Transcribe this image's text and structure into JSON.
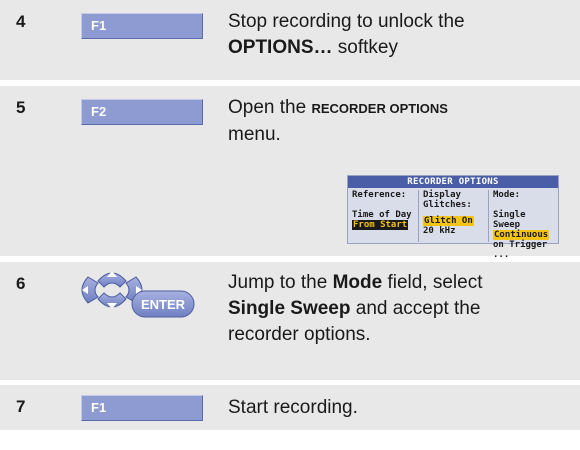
{
  "steps": [
    {
      "number": "4",
      "key_label": "F1",
      "desc_line1": "Stop recording to unlock the",
      "desc_bold": "OPTIONS…",
      "desc_after": " softkey"
    },
    {
      "number": "5",
      "key_label": "F2",
      "desc_before": "Open the ",
      "desc_bold": "RECORDER OPTIONS",
      "desc_after": "menu."
    },
    {
      "number": "6",
      "key_label": "ENTER",
      "desc_part1": "Jump to the ",
      "desc_bold1": "Mode",
      "desc_part2": " field, select",
      "desc_bold2": "Single Sweep",
      "desc_part3": " and accept the",
      "desc_part4": "recorder options."
    },
    {
      "number": "7",
      "key_label": "F1",
      "desc": "Start recording."
    }
  ],
  "recorder_options": {
    "title": "RECORDER OPTIONS",
    "col1": {
      "header": "Reference:",
      "opt1": "Time of Day",
      "opt2_selected": "From Start"
    },
    "col2": {
      "header1": "Display",
      "header2": "Glitches:",
      "opt1_selected": "Glitch On",
      "opt2": "20 kHz"
    },
    "col3": {
      "header": "Mode:",
      "opt1": "Single Sweep",
      "opt2_selected": "Continuous",
      "opt3": "on Trigger ..."
    }
  },
  "colors": {
    "row_bg": "#e8e8e8",
    "key_bg": "#8e9bd3",
    "panel_title_bg": "#4a5ea8",
    "highlight": "#f2c418"
  }
}
